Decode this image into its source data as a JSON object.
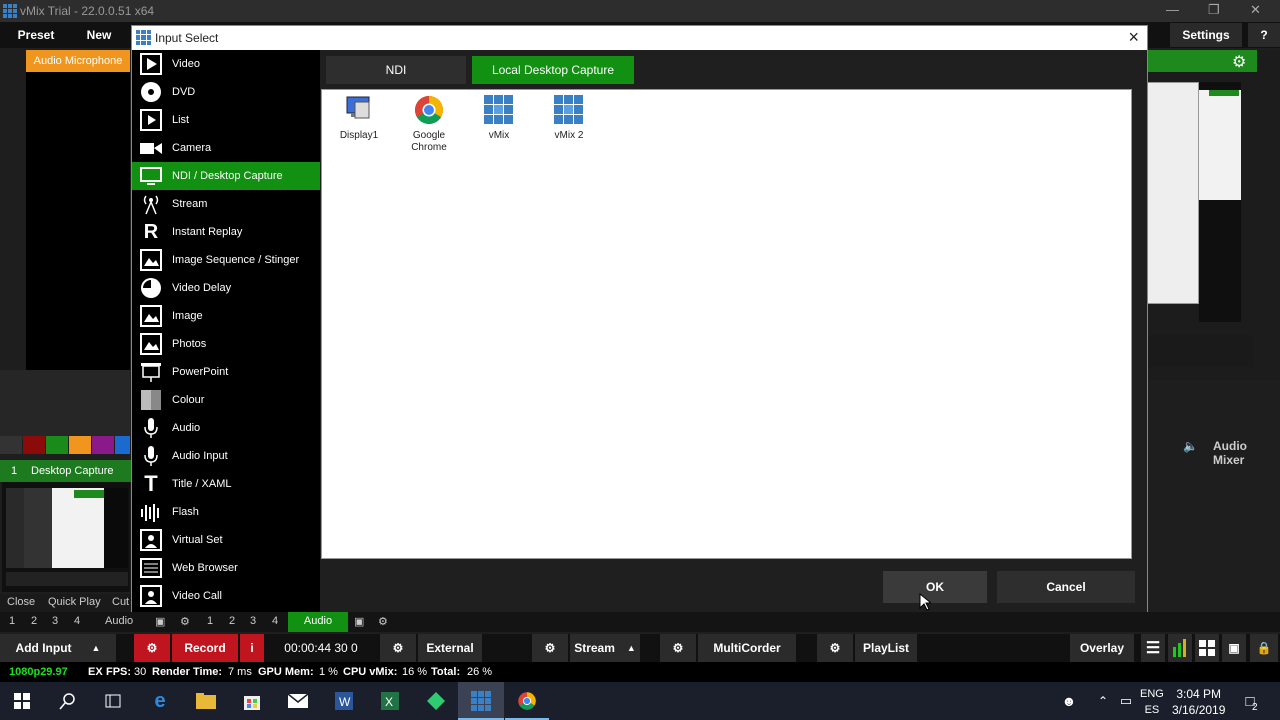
{
  "window": {
    "title": "vMix Trial - 22.0.0.51 x64"
  },
  "top_toolbar": {
    "preset": "Preset",
    "new": "New",
    "settings": "Settings",
    "help": "?"
  },
  "left": {
    "audio_microphone": "Audio Microphone",
    "input_number": "1",
    "input_name": "Desktop Capture",
    "buttons": {
      "close": "Close",
      "quick_play": "Quick Play",
      "cut": "Cut"
    },
    "swatch_colors": [
      "#333333",
      "#8b0a0a",
      "#1a8a1a",
      "#f0961e",
      "#8a1a8a",
      "#1a6ad0"
    ]
  },
  "right": {
    "audio_mixer": "Audio Mixer"
  },
  "dialog": {
    "title": "Input Select",
    "close": "×",
    "categories": [
      {
        "label": "Video",
        "icon": "video-icon"
      },
      {
        "label": "DVD",
        "icon": "dvd-icon"
      },
      {
        "label": "List",
        "icon": "list-icon"
      },
      {
        "label": "Camera",
        "icon": "camera-icon"
      },
      {
        "label": "NDI / Desktop Capture",
        "icon": "monitor-icon",
        "selected": true
      },
      {
        "label": "Stream",
        "icon": "stream-icon"
      },
      {
        "label": "Instant Replay",
        "icon": "replay-icon"
      },
      {
        "label": "Image Sequence / Stinger",
        "icon": "image-sequence-icon"
      },
      {
        "label": "Video Delay",
        "icon": "clock-icon"
      },
      {
        "label": "Image",
        "icon": "image-icon"
      },
      {
        "label": "Photos",
        "icon": "photos-icon"
      },
      {
        "label": "PowerPoint",
        "icon": "powerpoint-icon"
      },
      {
        "label": "Colour",
        "icon": "colour-icon"
      },
      {
        "label": "Audio",
        "icon": "microphone-icon"
      },
      {
        "label": "Audio Input",
        "icon": "microphone-icon"
      },
      {
        "label": "Title / XAML",
        "icon": "title-icon"
      },
      {
        "label": "Flash",
        "icon": "flash-icon"
      },
      {
        "label": "Virtual Set",
        "icon": "virtual-set-icon"
      },
      {
        "label": "Web Browser",
        "icon": "browser-icon"
      },
      {
        "label": "Video Call",
        "icon": "video-call-icon"
      }
    ],
    "tabs": [
      {
        "label": "NDI",
        "active": false
      },
      {
        "label": "Local Desktop Capture",
        "active": true
      }
    ],
    "files": [
      {
        "label": "Display1",
        "icon": "display-icon"
      },
      {
        "label": "Google Chrome",
        "icon": "chrome-icon"
      },
      {
        "label": "vMix",
        "icon": "vmix-icon"
      },
      {
        "label": "vMix 2",
        "icon": "vmix-icon"
      }
    ],
    "ok": "OK",
    "cancel": "Cancel"
  },
  "row1": {
    "nums_left": [
      "1",
      "2",
      "3",
      "4"
    ],
    "audio": "Audio",
    "nums_mid": [
      "1",
      "2",
      "3",
      "4"
    ],
    "audio_active": "Audio"
  },
  "bottom_bar": {
    "add_input": "Add Input",
    "record": "Record",
    "record_info": "i",
    "time": "00:00:44 30 0",
    "external": "External",
    "stream": "Stream",
    "multicorder": "MultiCorder",
    "playlist": "PlayList",
    "overlay": "Overlay"
  },
  "status": {
    "resolution": "1080p29.97",
    "ex": "EX",
    "fps_label": "FPS:",
    "fps": "30",
    "render_label": "Render Time:",
    "render": "7 ms",
    "gpu_label": "GPU Mem:",
    "gpu": "1 %",
    "cpu_label": "CPU vMix:",
    "cpu": "16 %",
    "total_label": "Total:",
    "total": "26 %"
  },
  "taskbar": {
    "lang1": "ENG",
    "lang2": "ES",
    "time": "3:04 PM",
    "date": "3/16/2019",
    "notifications": "2"
  },
  "colors": {
    "accent_green": "#119011",
    "orange": "#f0961e",
    "record_red": "#c0141e"
  }
}
